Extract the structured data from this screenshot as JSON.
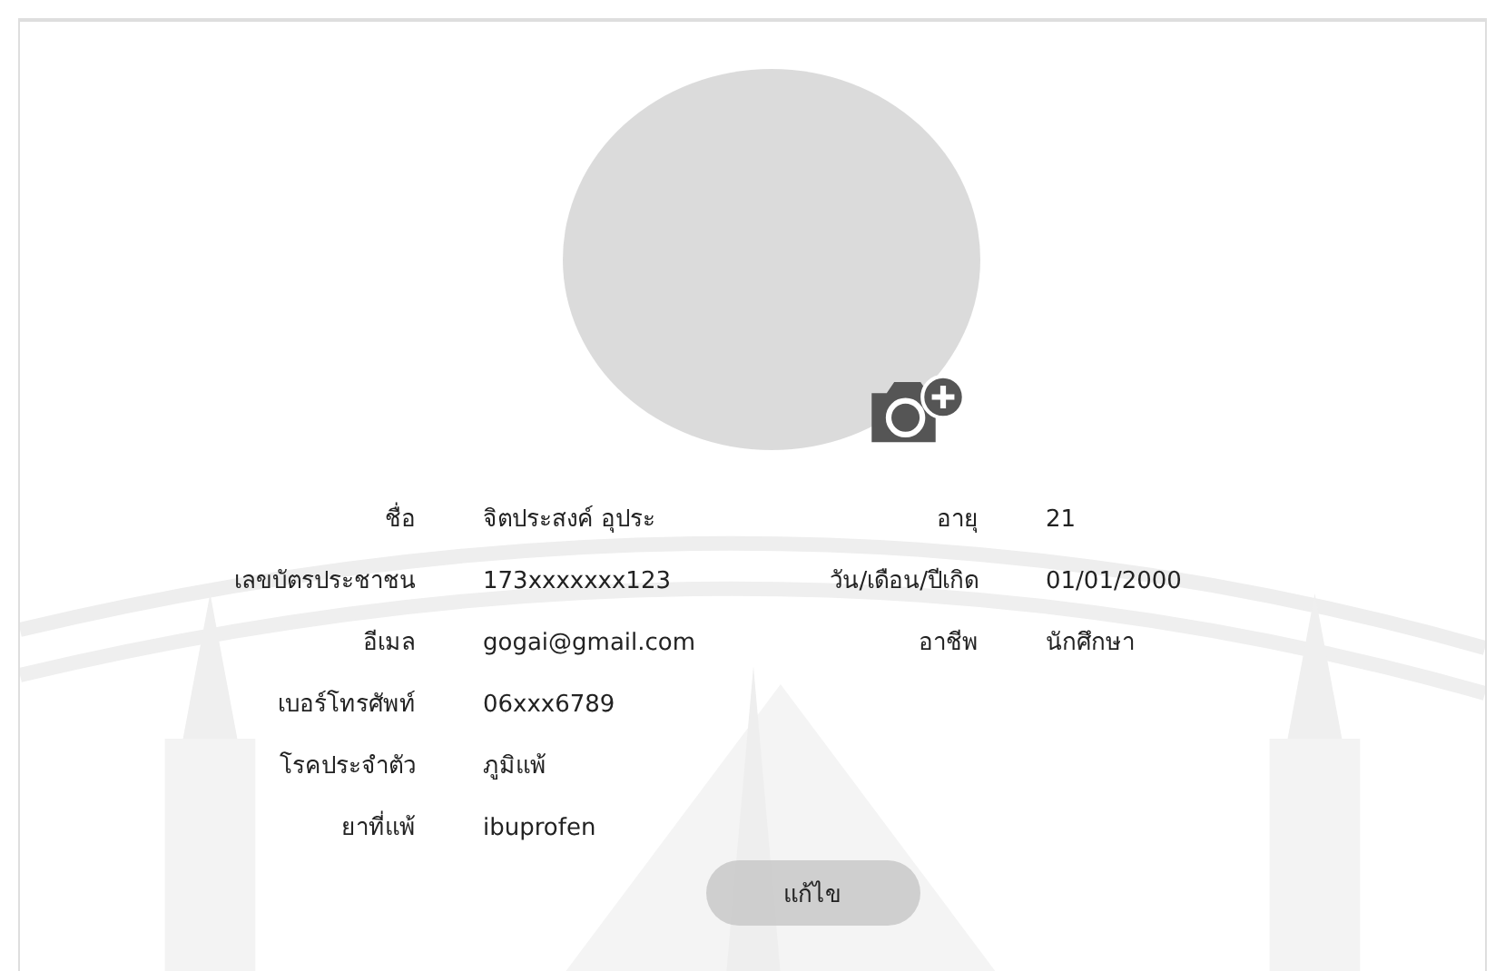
{
  "profile": {
    "left_fields": [
      {
        "label": "ชื่อ",
        "value": "จิตประสงค์ อุประ"
      },
      {
        "label": "เลขบัตรประชาชน",
        "value": "173xxxxxxx123"
      },
      {
        "label": "อีเมล",
        "value": "gogai@gmail.com"
      },
      {
        "label": "เบอร์โทรศัพท์",
        "value": "06xxx6789"
      },
      {
        "label": "โรคประจำตัว",
        "value": "ภูมิแพ้"
      },
      {
        "label": "ยาที่แพ้",
        "value": "ibuprofen"
      }
    ],
    "right_fields": [
      {
        "label": "อายุ",
        "value": "21"
      },
      {
        "label": "วัน/เดือน/ปีเกิด",
        "value": "01/01/2000"
      },
      {
        "label": "อาชีพ",
        "value": "นักศึกษา"
      }
    ],
    "edit_button": "แก้ไข"
  }
}
